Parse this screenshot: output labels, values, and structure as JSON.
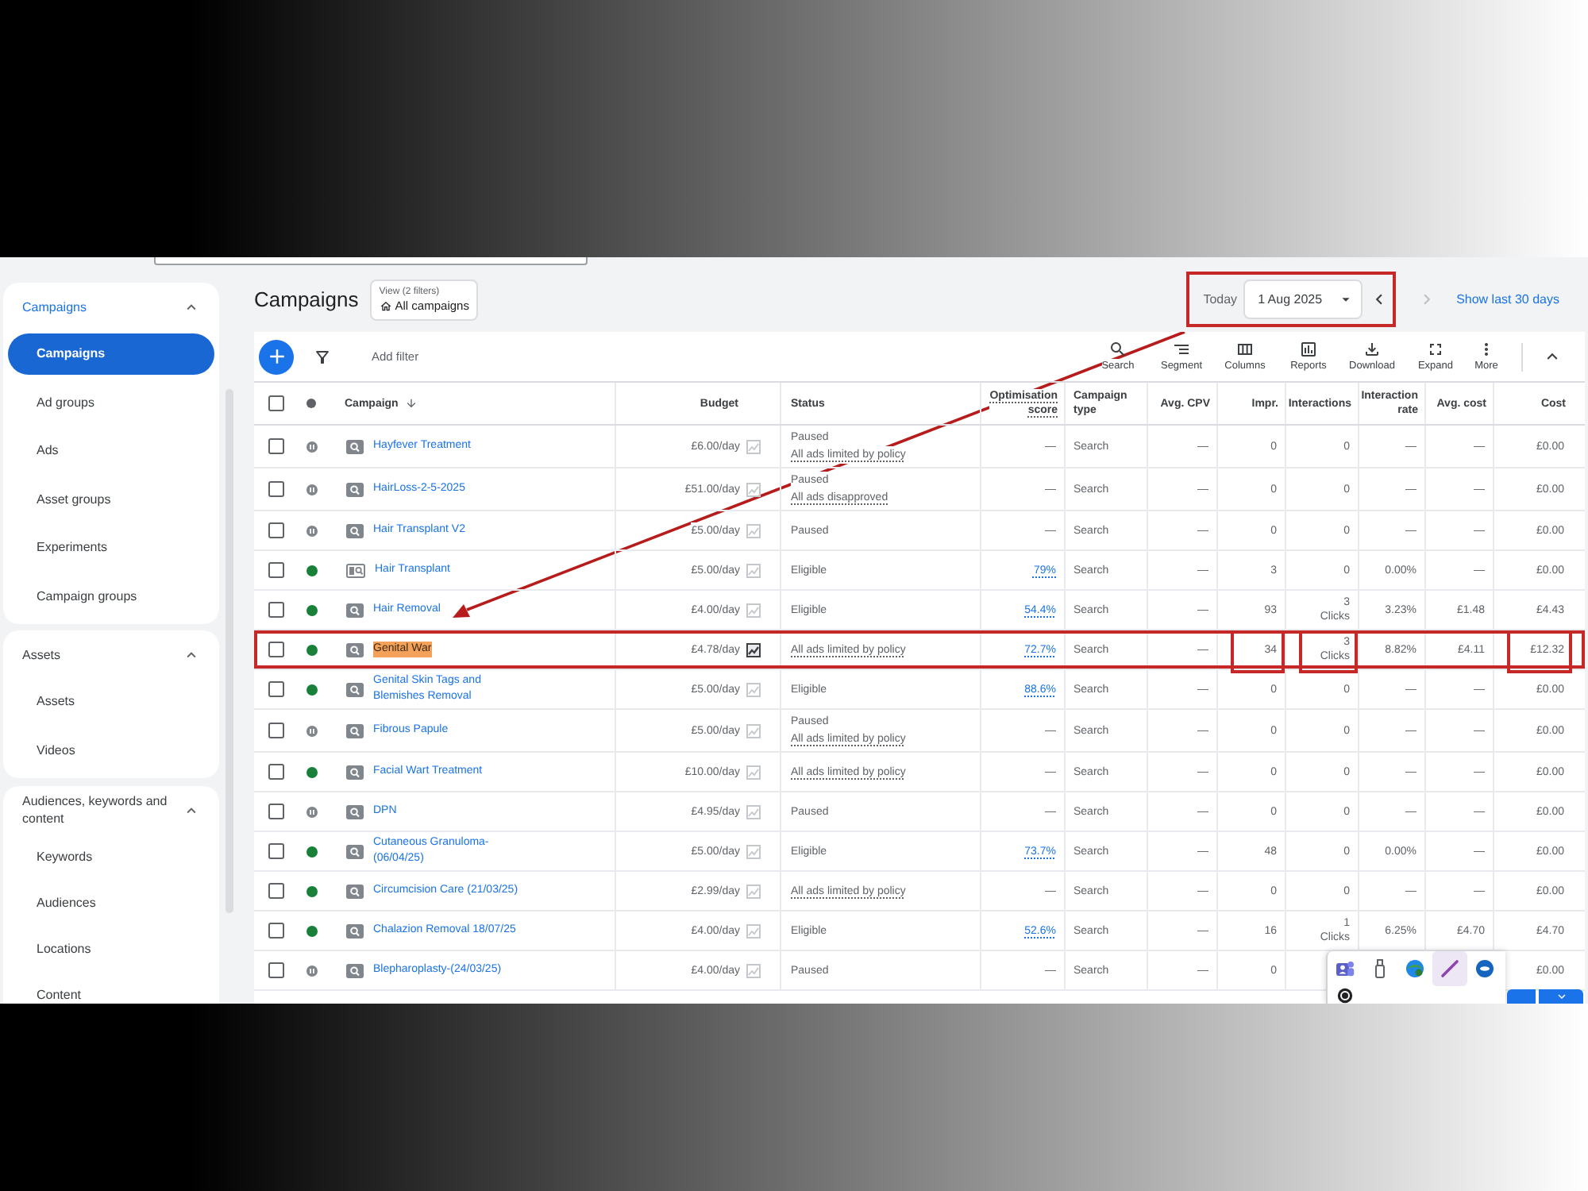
{
  "sidebar": {
    "sections": [
      {
        "title": "Campaigns",
        "active": true,
        "expanded": true,
        "items": [
          {
            "label": "Campaigns",
            "selected": true
          },
          {
            "label": "Ad groups",
            "selected": false
          },
          {
            "label": "Ads",
            "selected": false
          },
          {
            "label": "Asset groups",
            "selected": false
          },
          {
            "label": "Experiments",
            "selected": false
          },
          {
            "label": "Campaign groups",
            "selected": false
          }
        ]
      },
      {
        "title": "Assets",
        "active": false,
        "expanded": true,
        "items": [
          {
            "label": "Assets",
            "selected": false
          },
          {
            "label": "Videos",
            "selected": false
          }
        ]
      },
      {
        "title": "Audiences, keywords and content",
        "active": false,
        "expanded": true,
        "items": [
          {
            "label": "Keywords",
            "selected": false
          },
          {
            "label": "Audiences",
            "selected": false
          },
          {
            "label": "Locations",
            "selected": false
          },
          {
            "label": "Content",
            "selected": false
          }
        ]
      }
    ]
  },
  "header": {
    "title": "Campaigns",
    "view": {
      "label": "View (2 filters)",
      "value": "All campaigns"
    },
    "date": {
      "label": "Today",
      "value": "1 Aug 2025",
      "boxed": true,
      "arrow": true
    },
    "link": "Show last 30 days"
  },
  "toolbar": {
    "add_filter": "Add filter",
    "tools": [
      {
        "kind": "search",
        "label": "Search"
      },
      {
        "kind": "segment",
        "label": "Segment"
      },
      {
        "kind": "columns",
        "label": "Columns"
      },
      {
        "kind": "reports",
        "label": "Reports"
      },
      {
        "kind": "download",
        "label": "Download"
      },
      {
        "kind": "expand",
        "label": "Expand"
      },
      {
        "kind": "more",
        "label": "More"
      }
    ]
  },
  "table": {
    "select_all": {
      "checked": false
    },
    "columns": [
      {
        "label": "Campaign",
        "sorted": true,
        "underlined": false
      },
      {
        "label": "Budget",
        "sorted": false,
        "underlined": false
      },
      {
        "label": "Status",
        "sorted": false,
        "underlined": false
      },
      {
        "label": "Optimisation score",
        "sorted": false,
        "underlined": true
      },
      {
        "label": "Campaign type",
        "sorted": false,
        "underlined": false
      },
      {
        "label": "Avg. CPV",
        "sorted": false,
        "underlined": false
      },
      {
        "label": "Impr.",
        "sorted": false,
        "underlined": false
      },
      {
        "label": "Interactions",
        "sorted": false,
        "underlined": false
      },
      {
        "label": "Interaction rate",
        "sorted": false,
        "underlined": false
      },
      {
        "label": "Avg. cost",
        "sorted": false,
        "underlined": false
      },
      {
        "label": "Cost",
        "sorted": false,
        "underlined": false
      }
    ],
    "rows": [
      {
        "checked": false,
        "paused": true,
        "kind": "search",
        "name": "Hayfever Treatment",
        "find_highlight": false,
        "budget": "£6.00/day",
        "budget_icon_active": false,
        "status": [
          {
            "text": "Paused",
            "underlined": false
          },
          {
            "text": "All ads limited by policy",
            "underlined": true
          }
        ],
        "opt_score": "—",
        "score_link": false,
        "type": "Search",
        "avg_cpv": "—",
        "impr": "0",
        "interactions": "0",
        "interaction_rate": "—",
        "avg_cost": "—",
        "cost": "£0.00",
        "boxed": false,
        "impr_boxed": false,
        "interactions_boxed": false,
        "cost_boxed": false
      },
      {
        "checked": false,
        "paused": true,
        "kind": "search",
        "name": "HairLoss-2-5-2025",
        "find_highlight": false,
        "budget": "£51.00/day",
        "budget_icon_active": false,
        "status": [
          {
            "text": "Paused",
            "underlined": false
          },
          {
            "text": "All ads disapproved",
            "underlined": true
          }
        ],
        "opt_score": "—",
        "score_link": false,
        "type": "Search",
        "avg_cpv": "—",
        "impr": "0",
        "interactions": "0",
        "interaction_rate": "—",
        "avg_cost": "—",
        "cost": "£0.00",
        "boxed": false,
        "impr_boxed": false,
        "interactions_boxed": false,
        "cost_boxed": false
      },
      {
        "checked": false,
        "paused": true,
        "kind": "search",
        "name": "Hair Transplant V2",
        "find_highlight": false,
        "budget": "£5.00/day",
        "budget_icon_active": false,
        "status": [
          {
            "text": "Paused",
            "underlined": false
          }
        ],
        "opt_score": "—",
        "score_link": false,
        "type": "Search",
        "avg_cpv": "—",
        "impr": "0",
        "interactions": "0",
        "interaction_rate": "—",
        "avg_cost": "—",
        "cost": "£0.00",
        "boxed": false,
        "impr_boxed": false,
        "interactions_boxed": false,
        "cost_boxed": false
      },
      {
        "checked": false,
        "paused": false,
        "kind": "image_search",
        "name": "Hair Transplant",
        "find_highlight": false,
        "budget": "£5.00/day",
        "budget_icon_active": false,
        "status": [
          {
            "text": "Eligible",
            "underlined": false
          }
        ],
        "opt_score": "79%",
        "score_link": true,
        "type": "Search",
        "avg_cpv": "—",
        "impr": "3",
        "interactions": "0",
        "interaction_rate": "0.00%",
        "avg_cost": "—",
        "cost": "£0.00",
        "boxed": false,
        "impr_boxed": false,
        "interactions_boxed": false,
        "cost_boxed": false
      },
      {
        "checked": false,
        "paused": false,
        "kind": "search",
        "name": "Hair Removal",
        "find_highlight": false,
        "budget": "£4.00/day",
        "budget_icon_active": false,
        "status": [
          {
            "text": "Eligible",
            "underlined": false
          }
        ],
        "opt_score": "54.4%",
        "score_link": true,
        "type": "Search",
        "avg_cpv": "—",
        "impr": "93",
        "interactions": "3",
        "interactions_unit": "Clicks",
        "interaction_rate": "3.23%",
        "avg_cost": "£1.48",
        "cost": "£4.43",
        "boxed": false,
        "impr_boxed": false,
        "interactions_boxed": false,
        "cost_boxed": false
      },
      {
        "checked": false,
        "paused": false,
        "kind": "search",
        "name": "Genital War",
        "find_highlight": true,
        "budget": "£4.78/day",
        "budget_icon_active": true,
        "status": [
          {
            "text": "All ads limited by policy",
            "underlined": true
          }
        ],
        "opt_score": "72.7%",
        "score_link": true,
        "type": "Search",
        "avg_cpv": "—",
        "impr": "34",
        "interactions": "3",
        "interactions_unit": "Clicks",
        "interaction_rate": "8.82%",
        "avg_cost": "£4.11",
        "cost": "£12.32",
        "boxed": true,
        "impr_boxed": true,
        "interactions_boxed": true,
        "cost_boxed": true
      },
      {
        "checked": false,
        "paused": false,
        "kind": "search",
        "name": "Genital Skin Tags and Blemishes Removal",
        "find_highlight": false,
        "budget": "£5.00/day",
        "budget_icon_active": false,
        "status": [
          {
            "text": "Eligible",
            "underlined": false
          }
        ],
        "opt_score": "88.6%",
        "score_link": true,
        "type": "Search",
        "avg_cpv": "—",
        "impr": "0",
        "interactions": "0",
        "interaction_rate": "—",
        "avg_cost": "—",
        "cost": "£0.00",
        "boxed": false,
        "impr_boxed": false,
        "interactions_boxed": false,
        "cost_boxed": false
      },
      {
        "checked": false,
        "paused": true,
        "kind": "search",
        "name": "Fibrous Papule",
        "find_highlight": false,
        "budget": "£5.00/day",
        "budget_icon_active": false,
        "status": [
          {
            "text": "Paused",
            "underlined": false
          },
          {
            "text": "All ads limited by policy",
            "underlined": true
          }
        ],
        "opt_score": "—",
        "score_link": false,
        "type": "Search",
        "avg_cpv": "—",
        "impr": "0",
        "interactions": "0",
        "interaction_rate": "—",
        "avg_cost": "—",
        "cost": "£0.00",
        "boxed": false,
        "impr_boxed": false,
        "interactions_boxed": false,
        "cost_boxed": false
      },
      {
        "checked": false,
        "paused": false,
        "kind": "search",
        "name": "Facial Wart Treatment",
        "find_highlight": false,
        "budget": "£10.00/day",
        "budget_icon_active": false,
        "status": [
          {
            "text": "All ads limited by policy",
            "underlined": true
          }
        ],
        "opt_score": "—",
        "score_link": false,
        "type": "Search",
        "avg_cpv": "—",
        "impr": "0",
        "interactions": "0",
        "interaction_rate": "—",
        "avg_cost": "—",
        "cost": "£0.00",
        "boxed": false,
        "impr_boxed": false,
        "interactions_boxed": false,
        "cost_boxed": false
      },
      {
        "checked": false,
        "paused": true,
        "kind": "search",
        "name": "DPN",
        "find_highlight": false,
        "budget": "£4.95/day",
        "budget_icon_active": false,
        "status": [
          {
            "text": "Paused",
            "underlined": false
          }
        ],
        "opt_score": "—",
        "score_link": false,
        "type": "Search",
        "avg_cpv": "—",
        "impr": "0",
        "interactions": "0",
        "interaction_rate": "—",
        "avg_cost": "—",
        "cost": "£0.00",
        "boxed": false,
        "impr_boxed": false,
        "interactions_boxed": false,
        "cost_boxed": false
      },
      {
        "checked": false,
        "paused": false,
        "kind": "search",
        "name": "Cutaneous Granuloma-(06/04/25)",
        "find_highlight": false,
        "budget": "£5.00/day",
        "budget_icon_active": false,
        "status": [
          {
            "text": "Eligible",
            "underlined": false
          }
        ],
        "opt_score": "73.7%",
        "score_link": true,
        "type": "Search",
        "avg_cpv": "—",
        "impr": "48",
        "interactions": "0",
        "interaction_rate": "0.00%",
        "avg_cost": "—",
        "cost": "£0.00",
        "boxed": false,
        "impr_boxed": false,
        "interactions_boxed": false,
        "cost_boxed": false
      },
      {
        "checked": false,
        "paused": false,
        "kind": "search",
        "name": "Circumcision Care (21/03/25)",
        "find_highlight": false,
        "budget": "£2.99/day",
        "budget_icon_active": false,
        "status": [
          {
            "text": "All ads limited by policy",
            "underlined": true
          }
        ],
        "opt_score": "—",
        "score_link": false,
        "type": "Search",
        "avg_cpv": "—",
        "impr": "0",
        "interactions": "0",
        "interaction_rate": "—",
        "avg_cost": "—",
        "cost": "£0.00",
        "boxed": false,
        "impr_boxed": false,
        "interactions_boxed": false,
        "cost_boxed": false
      },
      {
        "checked": false,
        "paused": false,
        "kind": "search",
        "name": "Chalazion Removal 18/07/25",
        "find_highlight": false,
        "budget": "£4.00/day",
        "budget_icon_active": false,
        "status": [
          {
            "text": "Eligible",
            "underlined": false
          }
        ],
        "opt_score": "52.6%",
        "score_link": true,
        "type": "Search",
        "avg_cpv": "—",
        "impr": "16",
        "interactions": "1",
        "interactions_unit": "Clicks",
        "interaction_rate": "6.25%",
        "avg_cost": "£4.70",
        "cost": "£4.70",
        "boxed": false,
        "impr_boxed": false,
        "interactions_boxed": false,
        "cost_boxed": false
      },
      {
        "checked": false,
        "paused": true,
        "kind": "search",
        "name": "Blepharoplasty-(24/03/25)",
        "find_highlight": false,
        "budget": "£4.00/day",
        "budget_icon_active": false,
        "status": [
          {
            "text": "Paused",
            "underlined": false
          }
        ],
        "opt_score": "—",
        "score_link": false,
        "type": "Search",
        "avg_cpv": "—",
        "impr": "0",
        "cost": "£0.00",
        "boxed": false,
        "impr_boxed": false,
        "interactions_boxed": false,
        "cost_boxed": false
      }
    ]
  },
  "tray": {
    "rows": [
      {
        "icons": [
          {
            "kind": "people",
            "selected": false
          },
          {
            "kind": "usb",
            "selected": false
          },
          {
            "kind": "globe",
            "selected": false
          },
          {
            "kind": "pen",
            "selected": true
          },
          {
            "kind": "disc",
            "selected": false
          }
        ]
      },
      {
        "icons": [
          {
            "kind": "ring",
            "selected": false
          }
        ]
      }
    ]
  }
}
